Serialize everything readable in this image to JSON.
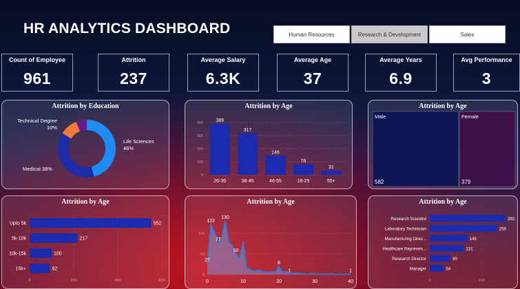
{
  "title": "HR ANALYTICS DASHBOARD",
  "slicer": {
    "buttons": [
      {
        "label": "Human Resources",
        "selected": false
      },
      {
        "label": "Research & Development",
        "selected": true
      },
      {
        "label": "Sales",
        "selected": false
      }
    ]
  },
  "kpis": [
    {
      "label": "Count of Employee",
      "value": "961"
    },
    {
      "label": "Attrition",
      "value": "237"
    },
    {
      "label": "Average Salary",
      "value": "6.3K"
    },
    {
      "label": "Average Age",
      "value": "37"
    },
    {
      "label": "Average Years",
      "value": "6.9"
    },
    {
      "label": "Avg Performance",
      "value": "3"
    }
  ],
  "panels": {
    "education": {
      "title": "Attrition by Education"
    },
    "age": {
      "title": "Attrition by Age"
    },
    "gender": {
      "title": "Attrition by Age"
    },
    "salary": {
      "title": "Attrition by Age"
    },
    "years": {
      "title": "Attrition by Age"
    },
    "role": {
      "title": "Attrition by Age"
    }
  },
  "colors": {
    "bar": "#1a2bb0",
    "donut": [
      "#1f8cf5",
      "#1b2da8",
      "#ef7a3a",
      "#6b1a8c"
    ],
    "area_line": "#2b7ad8",
    "area_fill": "#7b8fd6",
    "male_tile": "#0d1553",
    "female_tile": "#3a0f4a"
  },
  "chart_data": [
    {
      "id": "education",
      "type": "pie",
      "title": "Attrition by Education",
      "slices": [
        {
          "label": "Life Sciences",
          "pct_text": "46%",
          "value": 46
        },
        {
          "label": "Medical",
          "pct_text": "38%",
          "value": 38
        },
        {
          "label": "Technical Degree",
          "pct_text": "10%",
          "value": 10
        },
        {
          "label": "",
          "pct_text": "",
          "value": 6
        }
      ]
    },
    {
      "id": "age",
      "type": "bar",
      "title": "Attrition by Age",
      "categories": [
        "26-35",
        "36-45",
        "46-55",
        "18-25",
        "55+"
      ],
      "values": [
        389,
        317,
        146,
        78,
        31
      ],
      "yticks": [
        "0",
        "100",
        "200",
        "300",
        "400"
      ],
      "ylim": [
        0,
        400
      ],
      "grid": true
    },
    {
      "id": "gender",
      "type": "treemap",
      "title": "Attrition by Age",
      "items": [
        {
          "label": "Male",
          "value": 582
        },
        {
          "label": "Female",
          "value": 379
        }
      ]
    },
    {
      "id": "salary",
      "type": "bar",
      "orientation": "horizontal",
      "title": "Attrition by Age",
      "categories": [
        "Upto 5k",
        "5k-10k",
        "10k-15k",
        "15k+"
      ],
      "values": [
        552,
        217,
        100,
        92
      ],
      "xticks": [
        "0",
        "200",
        "400",
        "600"
      ],
      "xlim": [
        0,
        600
      ]
    },
    {
      "id": "years",
      "type": "area",
      "title": "Attrition by Age",
      "x": [
        0,
        1,
        2,
        3,
        4,
        5,
        6,
        7,
        8,
        9,
        10,
        11,
        12,
        13,
        14,
        15,
        16,
        17,
        18,
        19,
        20,
        21,
        22,
        23,
        24,
        25,
        26,
        27,
        28,
        29,
        30,
        31,
        32,
        33,
        34,
        35,
        36,
        37,
        38,
        39,
        40
      ],
      "y": [
        27,
        122,
        103,
        77,
        90,
        130,
        78,
        70,
        50,
        38,
        80,
        15,
        12,
        8,
        10,
        9,
        6,
        5,
        7,
        6,
        20,
        5,
        8,
        1,
        4,
        3,
        3,
        2,
        1,
        2,
        2,
        1,
        1,
        1,
        1,
        1,
        0,
        1,
        0,
        1,
        1
      ],
      "labeled_points": [
        {
          "x": 0,
          "text": "27"
        },
        {
          "x": 1,
          "text": "122"
        },
        {
          "x": 3,
          "text": "77"
        },
        {
          "x": 5,
          "text": "130"
        },
        {
          "x": 8,
          "text": "50"
        },
        {
          "x": 20,
          "text": "8"
        },
        {
          "x": 23,
          "text": "1"
        },
        {
          "x": 40,
          "text": "1"
        }
      ],
      "xticks": [
        "0",
        "10",
        "20",
        "30",
        "40"
      ],
      "yticks": [
        "0",
        "50",
        "100"
      ],
      "xlim": [
        0,
        40
      ],
      "ylim": [
        0,
        150
      ],
      "grid": true
    },
    {
      "id": "role",
      "type": "bar",
      "orientation": "horizontal",
      "title": "Attrition by Age",
      "categories": [
        "Research Scientist",
        "Laboratory Technician",
        "Manufacturing Direc...",
        "Healthcare Represen...",
        "Research Director",
        "Manager"
      ],
      "values": [
        292,
        259,
        145,
        131,
        80,
        54
      ],
      "xticks": [
        "0",
        "200"
      ],
      "xlim": [
        0,
        300
      ]
    }
  ]
}
